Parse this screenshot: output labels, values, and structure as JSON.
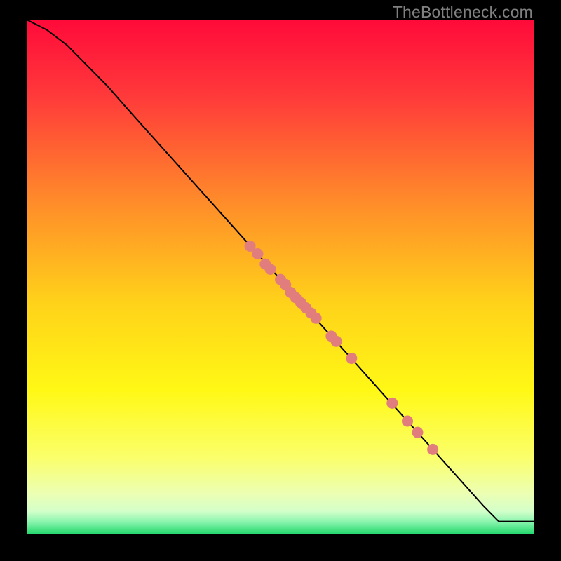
{
  "watermark": "TheBottleneck.com",
  "colors": {
    "point_fill": "#e27d7d",
    "curve_stroke": "#000000",
    "bg_black": "#000000"
  },
  "chart_data": {
    "type": "line",
    "title": "",
    "xlabel": "",
    "ylabel": "",
    "xlim": [
      0,
      100
    ],
    "ylim": [
      0,
      100
    ],
    "series": [
      {
        "name": "curve",
        "x": [
          0,
          4,
          8,
          12,
          16,
          20,
          30,
          40,
          50,
          60,
          70,
          80,
          90,
          93,
          100
        ],
        "y": [
          100,
          98,
          95,
          91,
          87,
          82.5,
          71.5,
          60.5,
          49.5,
          38.5,
          27.5,
          16.5,
          5.5,
          2.5,
          2.5
        ]
      },
      {
        "name": "points",
        "x": [
          44,
          45.5,
          47,
          48,
          50,
          51,
          52,
          53,
          54,
          55,
          56,
          57,
          60,
          61,
          64,
          72,
          75,
          77,
          80
        ],
        "y": [
          56,
          54.5,
          52.5,
          51.5,
          49.5,
          48.5,
          47,
          46,
          45,
          44,
          43,
          42,
          38.5,
          37.5,
          34.2,
          25.5,
          22,
          19.8,
          16.5
        ]
      }
    ],
    "gradient_stops": [
      {
        "offset": 0.0,
        "color": "#ff0a3a"
      },
      {
        "offset": 0.15,
        "color": "#ff3a3a"
      },
      {
        "offset": 0.35,
        "color": "#ff8a2a"
      },
      {
        "offset": 0.55,
        "color": "#ffd21a"
      },
      {
        "offset": 0.72,
        "color": "#fff815"
      },
      {
        "offset": 0.85,
        "color": "#fbff6a"
      },
      {
        "offset": 0.92,
        "color": "#ecffb2"
      },
      {
        "offset": 0.955,
        "color": "#d4ffca"
      },
      {
        "offset": 0.975,
        "color": "#8cf5af"
      },
      {
        "offset": 1.0,
        "color": "#1fd76a"
      }
    ]
  }
}
